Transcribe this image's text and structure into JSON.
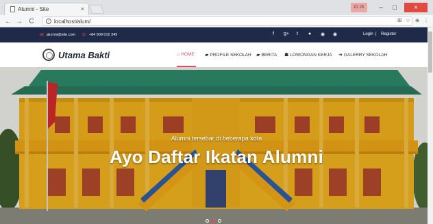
{
  "browser": {
    "tab_title": "Alumni - Site",
    "tab_close": "×",
    "url": "localhost/alum/",
    "badge": "ID 25",
    "win_min": "–",
    "win_max": "□",
    "win_close": "×",
    "back": "←",
    "forward": "→",
    "reload": "C",
    "info": "i"
  },
  "topbar": {
    "email": "alumni@site.com",
    "phone": "+84 909 015 345",
    "social": [
      "f",
      "g+",
      "t",
      "●",
      "◉",
      "◉"
    ],
    "login": "Login",
    "separator": "|",
    "register": "Register"
  },
  "header": {
    "brand": "Utama Bakti",
    "menu": [
      {
        "label": "HOME",
        "icon": "⌂",
        "active": true
      },
      {
        "label": "PROFILE SEKOLAH",
        "icon": "▰",
        "active": false
      },
      {
        "label": "BERITA",
        "icon": "▰",
        "active": false
      },
      {
        "label": "LOWONGAN KERJA",
        "icon": "☗",
        "active": false
      },
      {
        "label": "GALERRY SEKOLAH",
        "icon": "➜",
        "active": false
      }
    ]
  },
  "hero": {
    "subtitle": "Alumni tersebar di beberapa kota",
    "title": "Ayo Daftar Ikatan Alumni"
  },
  "colors": {
    "navy": "#1f2a48",
    "accent": "#e64b5c",
    "building_yellow": "#f2b21c",
    "roof_green": "#2f8a6c"
  }
}
